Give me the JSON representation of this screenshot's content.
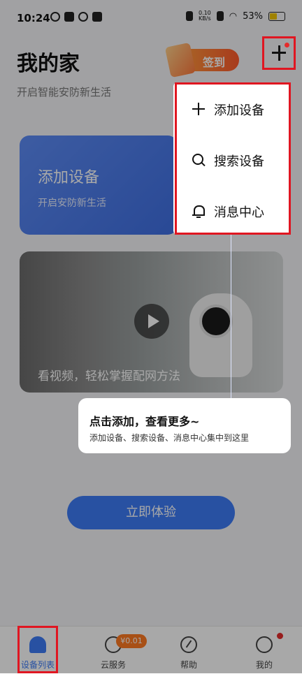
{
  "status_bar": {
    "time": "10:24",
    "speed_value": "0.10",
    "speed_unit": "KB/s",
    "battery": "53%"
  },
  "header": {
    "title": "我的家",
    "subtitle": "开启智能安防新生活",
    "signin_label": "签到"
  },
  "add_card": {
    "title": "添加设备",
    "subtitle": "开启安防新生活"
  },
  "video_card": {
    "caption": "看视频，轻松掌握配网方法"
  },
  "cta": {
    "label": "立即体验"
  },
  "dropdown": {
    "items": [
      {
        "label": "添加设备",
        "icon": "plus-icon"
      },
      {
        "label": "搜索设备",
        "icon": "search-icon"
      },
      {
        "label": "消息中心",
        "icon": "bell-icon"
      }
    ]
  },
  "tooltip": {
    "title": "点击添加，查看更多~",
    "body": "添加设备、搜索设备、消息中心集中到这里"
  },
  "tabbar": {
    "items": [
      {
        "label": "设备列表",
        "icon": "home-icon",
        "active": true
      },
      {
        "label": "云服务",
        "icon": "cloud-icon",
        "badge": "¥0.01"
      },
      {
        "label": "帮助",
        "icon": "compass-icon"
      },
      {
        "label": "我的",
        "icon": "smile-icon"
      }
    ]
  },
  "colors": {
    "accent": "#3d7cf6",
    "highlight_box": "#e01621",
    "badge": "#ff7a22"
  }
}
